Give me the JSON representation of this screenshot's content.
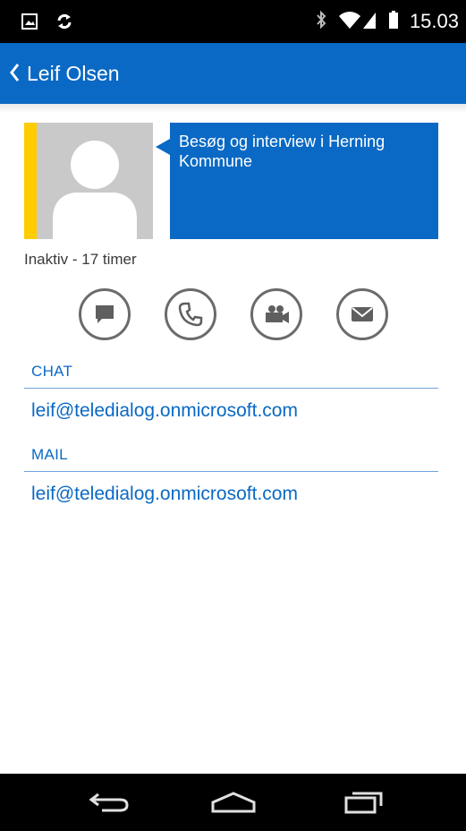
{
  "status_bar": {
    "time": "15.03",
    "icons": [
      "image-icon",
      "sync-icon",
      "bluetooth-icon",
      "wifi-icon",
      "signal-icon",
      "battery-icon"
    ]
  },
  "app_bar": {
    "title": "Leif Olsen",
    "background": "#0a69c4"
  },
  "profile": {
    "note": "Besøg og interview i Herning Kommune",
    "presence_color": "#ffcc00",
    "status": "Inaktiv - 17 timer"
  },
  "actions": [
    {
      "icon": "chat-icon"
    },
    {
      "icon": "phone-icon"
    },
    {
      "icon": "video-icon"
    },
    {
      "icon": "mail-icon"
    }
  ],
  "sections": {
    "chat": {
      "header": "CHAT",
      "value": "leif@teledialog.onmicrosoft.com"
    },
    "mail": {
      "header": "MAIL",
      "value": "leif@teledialog.onmicrosoft.com"
    }
  },
  "nav_bar": {
    "icons": [
      "back-icon",
      "home-icon",
      "recents-icon"
    ]
  }
}
